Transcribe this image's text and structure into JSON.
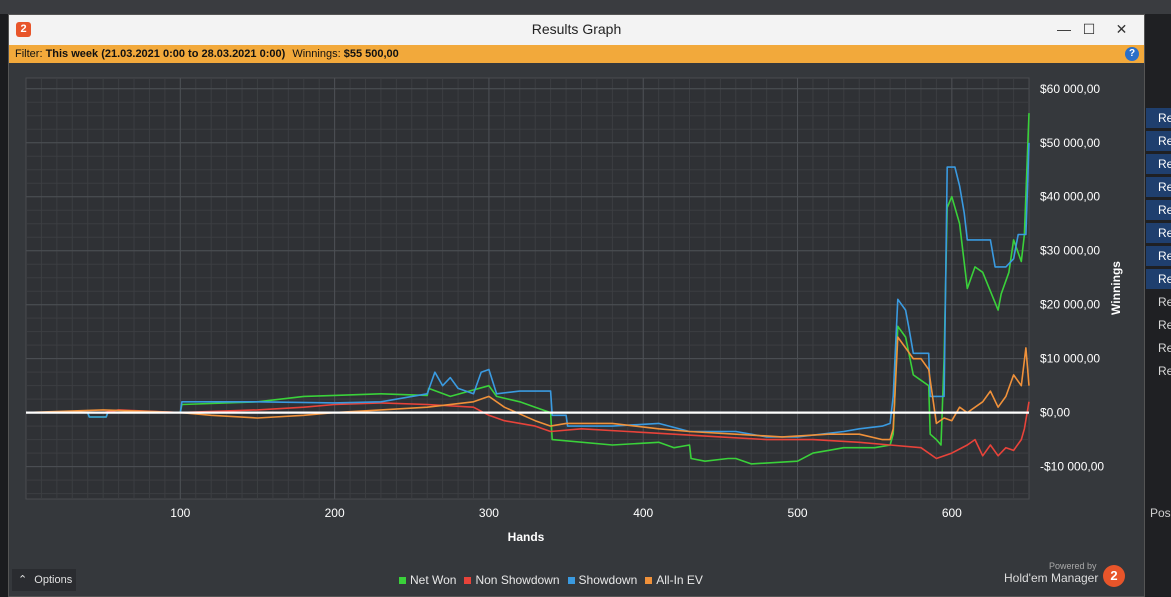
{
  "window": {
    "title": "Results Graph",
    "minimize_label": "—",
    "maximize_label": "☐",
    "close_label": "✕",
    "app_icon_label": "2"
  },
  "filter": {
    "filter_label": "Filter:",
    "filter_value": "This week (21.03.2021 0:00 to 28.03.2021 0:00)",
    "winnings_label": "Winnings:",
    "winnings_value": "$55 500,00",
    "help_label": "?"
  },
  "footer": {
    "options_label": "Options",
    "powered_by": "Powered by",
    "brand": "Hold'em Manager",
    "brand_logo": "2"
  },
  "background_window": {
    "items": [
      "Re",
      "Re",
      "Re",
      "Re",
      "Re",
      "Re",
      "Re",
      "Re",
      "Re",
      "Re",
      "Re",
      "Re"
    ],
    "pos_label": "Pos"
  },
  "colors": {
    "net_won": "#3ad13a",
    "non_showdown": "#e8433a",
    "showdown": "#3a9ae0",
    "all_in_ev": "#f0913a",
    "zero_line": "#ffffff",
    "plot_bg": "#2f3135"
  },
  "chart_data": {
    "type": "line",
    "xlabel": "Hands",
    "ylabel": "Winnings",
    "xlim": [
      0,
      650
    ],
    "ylim": [
      -16000,
      62000
    ],
    "x_ticks": [
      100,
      200,
      300,
      400,
      500,
      600
    ],
    "y_ticks": [
      -10000,
      0,
      10000,
      20000,
      30000,
      40000,
      50000,
      60000
    ],
    "y_tick_labels": [
      "-$10 000,00",
      "$0,00",
      "$10 000,00",
      "$20 000,00",
      "$30 000,00",
      "$40 000,00",
      "$50 000,00",
      "$60 000,00"
    ],
    "grid": true,
    "legend_position": "bottom",
    "series": [
      {
        "name": "Net Won",
        "color_key": "net_won",
        "points": [
          [
            0,
            0
          ],
          [
            40,
            0
          ],
          [
            41,
            -800
          ],
          [
            52,
            -800
          ],
          [
            53,
            0
          ],
          [
            100,
            0
          ],
          [
            101,
            1500
          ],
          [
            150,
            2000
          ],
          [
            180,
            3000
          ],
          [
            200,
            3200
          ],
          [
            230,
            3500
          ],
          [
            260,
            3200
          ],
          [
            261,
            4500
          ],
          [
            275,
            3000
          ],
          [
            300,
            5000
          ],
          [
            305,
            3000
          ],
          [
            320,
            2000
          ],
          [
            330,
            1000
          ],
          [
            340,
            0
          ],
          [
            341,
            -5000
          ],
          [
            380,
            -6000
          ],
          [
            410,
            -5500
          ],
          [
            420,
            -6500
          ],
          [
            430,
            -6000
          ],
          [
            431,
            -8500
          ],
          [
            440,
            -9000
          ],
          [
            455,
            -8500
          ],
          [
            460,
            -8500
          ],
          [
            470,
            -9500
          ],
          [
            500,
            -9000
          ],
          [
            510,
            -7500
          ],
          [
            520,
            -7000
          ],
          [
            530,
            -6500
          ],
          [
            550,
            -6500
          ],
          [
            560,
            -6000
          ],
          [
            562,
            -4000
          ],
          [
            565,
            16000
          ],
          [
            570,
            14000
          ],
          [
            575,
            7000
          ],
          [
            580,
            6000
          ],
          [
            585,
            5000
          ],
          [
            586,
            -4000
          ],
          [
            590,
            -5000
          ],
          [
            593,
            -6000
          ],
          [
            595,
            10000
          ],
          [
            597,
            38000
          ],
          [
            600,
            40000
          ],
          [
            605,
            35000
          ],
          [
            610,
            23000
          ],
          [
            615,
            27000
          ],
          [
            620,
            26000
          ],
          [
            630,
            19000
          ],
          [
            632,
            22000
          ],
          [
            637,
            26000
          ],
          [
            640,
            32000
          ],
          [
            645,
            28000
          ],
          [
            647,
            33000
          ],
          [
            650,
            55500
          ]
        ]
      },
      {
        "name": "Non Showdown",
        "color_key": "non_showdown",
        "points": [
          [
            0,
            0
          ],
          [
            50,
            0
          ],
          [
            60,
            500
          ],
          [
            100,
            0
          ],
          [
            150,
            500
          ],
          [
            180,
            1000
          ],
          [
            200,
            1500
          ],
          [
            230,
            1800
          ],
          [
            260,
            1500
          ],
          [
            290,
            1000
          ],
          [
            300,
            -500
          ],
          [
            310,
            -1500
          ],
          [
            330,
            -2500
          ],
          [
            340,
            -3500
          ],
          [
            360,
            -3000
          ],
          [
            390,
            -3500
          ],
          [
            420,
            -4000
          ],
          [
            450,
            -4500
          ],
          [
            480,
            -5000
          ],
          [
            510,
            -5000
          ],
          [
            540,
            -5500
          ],
          [
            560,
            -6000
          ],
          [
            580,
            -6500
          ],
          [
            590,
            -8500
          ],
          [
            600,
            -7500
          ],
          [
            610,
            -6000
          ],
          [
            615,
            -5000
          ],
          [
            620,
            -8000
          ],
          [
            625,
            -6000
          ],
          [
            630,
            -8000
          ],
          [
            635,
            -6500
          ],
          [
            640,
            -7000
          ],
          [
            645,
            -5000
          ],
          [
            647,
            -3000
          ],
          [
            650,
            2000
          ]
        ]
      },
      {
        "name": "Showdown",
        "color_key": "showdown",
        "points": [
          [
            0,
            0
          ],
          [
            40,
            0
          ],
          [
            41,
            -800
          ],
          [
            52,
            -800
          ],
          [
            53,
            0
          ],
          [
            100,
            0
          ],
          [
            101,
            2000
          ],
          [
            150,
            2000
          ],
          [
            200,
            1800
          ],
          [
            230,
            2000
          ],
          [
            260,
            3500
          ],
          [
            265,
            7500
          ],
          [
            270,
            5000
          ],
          [
            275,
            6500
          ],
          [
            280,
            4500
          ],
          [
            290,
            3500
          ],
          [
            295,
            7500
          ],
          [
            300,
            8000
          ],
          [
            305,
            3500
          ],
          [
            320,
            4000
          ],
          [
            340,
            4000
          ],
          [
            341,
            -500
          ],
          [
            350,
            -500
          ],
          [
            351,
            -2500
          ],
          [
            380,
            -2500
          ],
          [
            410,
            -2000
          ],
          [
            430,
            -3500
          ],
          [
            460,
            -3500
          ],
          [
            480,
            -4500
          ],
          [
            500,
            -4500
          ],
          [
            530,
            -3500
          ],
          [
            540,
            -3000
          ],
          [
            555,
            -2500
          ],
          [
            560,
            -2000
          ],
          [
            562,
            3000
          ],
          [
            565,
            21000
          ],
          [
            570,
            19000
          ],
          [
            572,
            16000
          ],
          [
            575,
            11000
          ],
          [
            580,
            11000
          ],
          [
            585,
            11000
          ],
          [
            586,
            3000
          ],
          [
            590,
            3000
          ],
          [
            595,
            3000
          ],
          [
            597,
            45500
          ],
          [
            602,
            45500
          ],
          [
            605,
            42000
          ],
          [
            608,
            37000
          ],
          [
            610,
            32000
          ],
          [
            625,
            32000
          ],
          [
            628,
            27000
          ],
          [
            635,
            27000
          ],
          [
            640,
            28500
          ],
          [
            643,
            33000
          ],
          [
            648,
            33000
          ],
          [
            650,
            50000
          ]
        ]
      },
      {
        "name": "All-In EV",
        "color_key": "all_in_ev",
        "points": [
          [
            0,
            0
          ],
          [
            50,
            500
          ],
          [
            100,
            0
          ],
          [
            120,
            -500
          ],
          [
            150,
            -1000
          ],
          [
            180,
            -500
          ],
          [
            200,
            0
          ],
          [
            230,
            500
          ],
          [
            260,
            1000
          ],
          [
            290,
            2000
          ],
          [
            300,
            3000
          ],
          [
            310,
            1000
          ],
          [
            330,
            -1500
          ],
          [
            340,
            -2500
          ],
          [
            350,
            -2000
          ],
          [
            380,
            -2000
          ],
          [
            410,
            -3000
          ],
          [
            430,
            -3500
          ],
          [
            460,
            -4000
          ],
          [
            490,
            -4500
          ],
          [
            520,
            -4000
          ],
          [
            540,
            -4000
          ],
          [
            555,
            -5000
          ],
          [
            560,
            -5000
          ],
          [
            562,
            -3000
          ],
          [
            565,
            14000
          ],
          [
            570,
            12000
          ],
          [
            575,
            10000
          ],
          [
            580,
            10000
          ],
          [
            585,
            8000
          ],
          [
            590,
            -2000
          ],
          [
            595,
            -1000
          ],
          [
            600,
            -1500
          ],
          [
            605,
            1000
          ],
          [
            610,
            0
          ],
          [
            620,
            2000
          ],
          [
            625,
            4000
          ],
          [
            630,
            1000
          ],
          [
            635,
            3000
          ],
          [
            640,
            7000
          ],
          [
            645,
            5000
          ],
          [
            648,
            12000
          ],
          [
            650,
            5000
          ]
        ]
      }
    ]
  }
}
